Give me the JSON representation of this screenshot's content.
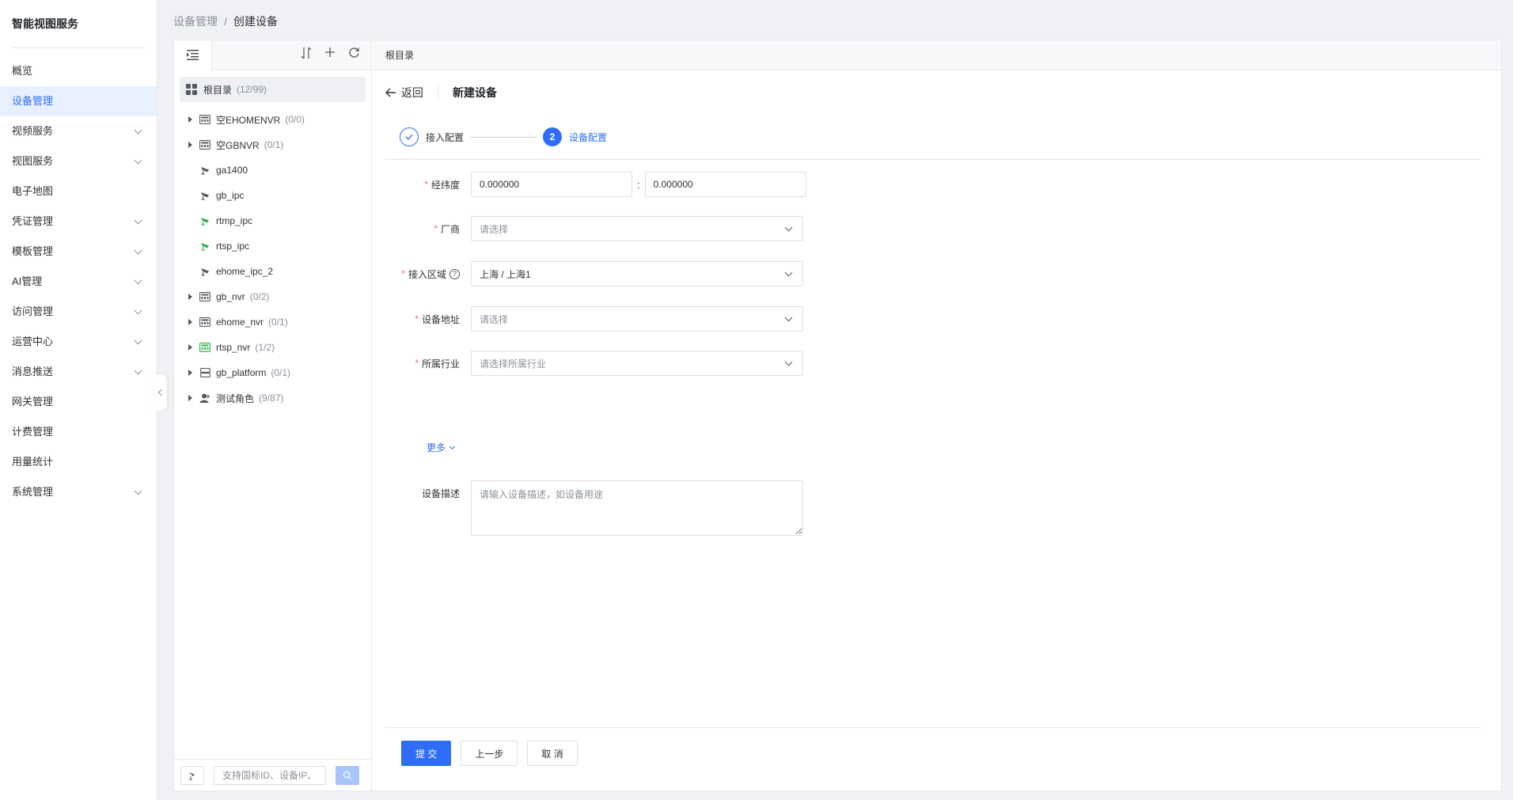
{
  "app": {
    "title": "智能视图服务"
  },
  "sidebar": {
    "items": [
      {
        "label": "概览",
        "expandable": false
      },
      {
        "label": "设备管理",
        "expandable": false,
        "active": true
      },
      {
        "label": "视频服务",
        "expandable": true
      },
      {
        "label": "视图服务",
        "expandable": true
      },
      {
        "label": "电子地图",
        "expandable": false
      },
      {
        "label": "凭证管理",
        "expandable": true
      },
      {
        "label": "模板管理",
        "expandable": true
      },
      {
        "label": "AI管理",
        "expandable": true
      },
      {
        "label": "访问管理",
        "expandable": true
      },
      {
        "label": "运营中心",
        "expandable": true
      },
      {
        "label": "消息推送",
        "expandable": true
      },
      {
        "label": "网关管理",
        "expandable": false
      },
      {
        "label": "计费管理",
        "expandable": false
      },
      {
        "label": "用量统计",
        "expandable": false
      },
      {
        "label": "系统管理",
        "expandable": true
      }
    ]
  },
  "breadcrumb": {
    "parent": "设备管理",
    "separator": "/",
    "current": "创建设备"
  },
  "tree": {
    "root": {
      "label": "根目录",
      "count": "(12/99)"
    },
    "nodes": [
      {
        "label": "空EHOMENVR",
        "count": "(0/0)",
        "icon": "nvr-icon",
        "expandable": true,
        "online": false
      },
      {
        "label": "空GBNVR",
        "count": "(0/1)",
        "icon": "nvr-icon",
        "expandable": true,
        "online": false
      },
      {
        "label": "ga1400",
        "count": "",
        "icon": "camera-icon",
        "expandable": false,
        "online": false
      },
      {
        "label": "gb_ipc",
        "count": "",
        "icon": "camera-icon",
        "expandable": false,
        "online": false
      },
      {
        "label": "rtmp_ipc",
        "count": "",
        "icon": "camera-icon",
        "expandable": false,
        "online": true
      },
      {
        "label": "rtsp_ipc",
        "count": "",
        "icon": "camera-icon",
        "expandable": false,
        "online": true
      },
      {
        "label": "ehome_ipc_2",
        "count": "",
        "icon": "camera-icon",
        "expandable": false,
        "online": false
      },
      {
        "label": "gb_nvr",
        "count": "(0/2)",
        "icon": "nvr-icon",
        "expandable": true,
        "online": false
      },
      {
        "label": "ehome_nvr",
        "count": "(0/1)",
        "icon": "nvr-icon",
        "expandable": true,
        "online": false
      },
      {
        "label": "rtsp_nvr",
        "count": "(1/2)",
        "icon": "nvr-icon",
        "expandable": true,
        "online": true
      },
      {
        "label": "gb_platform",
        "count": "(0/1)",
        "icon": "platform-icon",
        "expandable": true,
        "online": false
      },
      {
        "label": "测试角色",
        "count": "(9/87)",
        "icon": "user-group-icon",
        "expandable": true,
        "online": false
      }
    ],
    "search_placeholder": "支持国标ID、设备IP、"
  },
  "content": {
    "header": "根目录",
    "back_label": "返回",
    "title": "新建设备",
    "steps": [
      {
        "label": "接入配置",
        "status": "done"
      },
      {
        "number": "2",
        "label": "设备配置",
        "status": "current"
      }
    ]
  },
  "form": {
    "coords": {
      "label": "经纬度",
      "required": true,
      "lon": "0.000000",
      "colon": ":",
      "lat": "0.000000"
    },
    "vendor": {
      "label": "厂商",
      "required": true,
      "placeholder": "请选择"
    },
    "region": {
      "label": "接入区域",
      "required": true,
      "value": "上海 / 上海1",
      "help": "?"
    },
    "address": {
      "label": "设备地址",
      "required": true,
      "placeholder": "请选择"
    },
    "industry": {
      "label": "所属行业",
      "required": true,
      "placeholder": "请选择所属行业"
    },
    "more": "更多",
    "description": {
      "label": "设备描述",
      "placeholder": "请输入设备描述，如设备用途"
    }
  },
  "footer": {
    "submit": "提 交",
    "prev": "上一步",
    "cancel": "取 消"
  },
  "colors": {
    "primary": "#2f6df6",
    "online": "#2db34a",
    "required": "#f56c6c",
    "active_bg": "#e8f0fe"
  }
}
